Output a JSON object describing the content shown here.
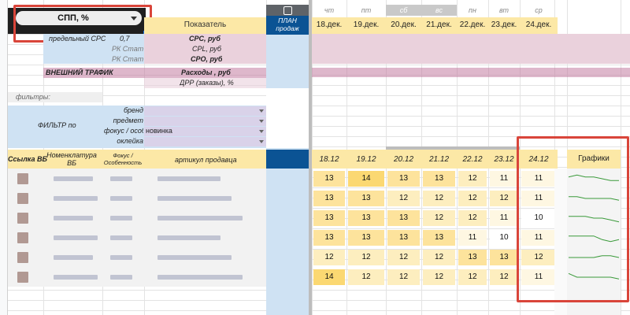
{
  "selector": {
    "value": "СПП, %"
  },
  "top_header": {
    "indicator_label": "Показатель",
    "plan_label": "ПЛАН продаж",
    "weekdays": [
      "чт",
      "пт",
      "сб",
      "вс",
      "пн",
      "вт",
      "ср"
    ],
    "dates": [
      "18.дек.",
      "19.дек.",
      "20.дек.",
      "21.дек.",
      "22.дек.",
      "23.дек.",
      "24.дек."
    ]
  },
  "rows": {
    "cpc_label": "предельный CPC",
    "cpc_value": "0,7",
    "cps": "CPC, руб",
    "rk_stat_1": "РК Стат",
    "cpl": "CPL, руб",
    "rk_stat_2": "РК Стат",
    "cpo": "CPO, руб",
    "external_traffic": "ВНЕШНИЙ ТРАФИК",
    "expenses": "Расходы , руб",
    "drr": "ДРР (заказы), %"
  },
  "filters": {
    "title": "фильтры:",
    "filter_by": "ФИЛЬТР по",
    "items": [
      {
        "label": "бренд",
        "value": ""
      },
      {
        "label": "предмет",
        "value": ""
      },
      {
        "label": "фокус / особ",
        "value": "новинка"
      },
      {
        "label": "оклейка",
        "value": ""
      }
    ]
  },
  "table": {
    "headers": {
      "link": "Ссылка ВБ",
      "nomenclature": "Номенклатура ВБ",
      "focus": "Фокус / Особенность",
      "article": "артикул продавца",
      "charts": "Графики"
    },
    "dates": [
      "18.12",
      "19.12",
      "20.12",
      "21.12",
      "22.12",
      "23.12",
      "24.12"
    ],
    "values": [
      [
        13,
        14,
        13,
        13,
        12,
        11,
        11
      ],
      [
        13,
        13,
        12,
        12,
        12,
        12,
        11
      ],
      [
        13,
        13,
        13,
        12,
        12,
        11,
        10
      ],
      [
        13,
        13,
        13,
        13,
        11,
        10,
        11
      ],
      [
        12,
        12,
        12,
        12,
        13,
        13,
        12
      ],
      [
        14,
        12,
        12,
        12,
        12,
        12,
        11
      ]
    ]
  },
  "colors": {
    "header_yellow": "#fce8a6",
    "pink": "#ead1dc",
    "blue": "#cfe2f3",
    "lavender": "#d9d2e9",
    "accent_red": "#d9453a",
    "plan_blue": "#0b5394",
    "spark_green": "#3a9a3a"
  }
}
